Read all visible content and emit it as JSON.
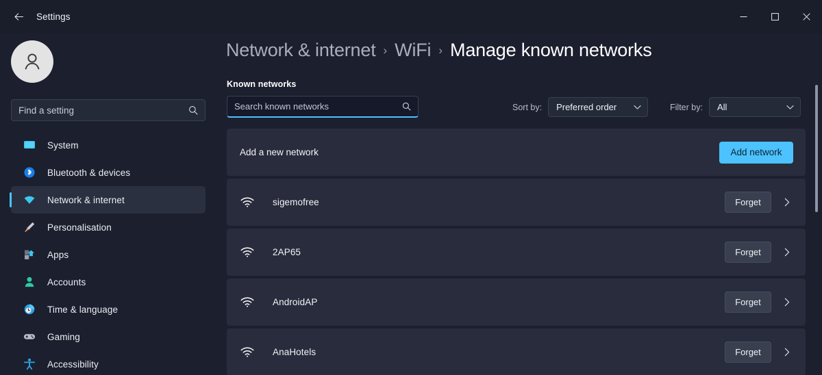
{
  "titlebar": {
    "back_label": "back-arrow",
    "app_title": "Settings",
    "minimize": "−",
    "maximize": "☐",
    "close": "✕"
  },
  "sidebar": {
    "search": {
      "placeholder": "Find a setting",
      "value": ""
    },
    "items": [
      {
        "label": "System",
        "icon": "monitor-icon",
        "active": false
      },
      {
        "label": "Bluetooth & devices",
        "icon": "bluetooth-icon",
        "active": false
      },
      {
        "label": "Network & internet",
        "icon": "wifi-icon",
        "active": true
      },
      {
        "label": "Personalisation",
        "icon": "paintbrush-icon",
        "active": false
      },
      {
        "label": "Apps",
        "icon": "apps-icon",
        "active": false
      },
      {
        "label": "Accounts",
        "icon": "person-icon",
        "active": false
      },
      {
        "label": "Time & language",
        "icon": "clock-icon",
        "active": false
      },
      {
        "label": "Gaming",
        "icon": "gamepad-icon",
        "active": false
      },
      {
        "label": "Accessibility",
        "icon": "accessibility-icon",
        "active": false
      }
    ]
  },
  "main": {
    "breadcrumb": [
      {
        "label": "Network & internet",
        "current": false
      },
      {
        "label": "WiFi",
        "current": false
      },
      {
        "label": "Manage known networks",
        "current": true
      }
    ],
    "breadcrumb_separator": "›",
    "section_label": "Known networks",
    "search": {
      "placeholder": "Search known networks",
      "value": ""
    },
    "sort": {
      "caption": "Sort by:",
      "value": "Preferred order"
    },
    "filter": {
      "caption": "Filter by:",
      "value": "All"
    },
    "add_network_row": {
      "text": "Add a new network",
      "button_label": "Add network"
    },
    "forget_label": "Forget",
    "networks": [
      {
        "name": "sigemofree"
      },
      {
        "name": "2AP65"
      },
      {
        "name": "AndroidAP"
      },
      {
        "name": "AnaHotels"
      }
    ]
  },
  "colors": {
    "accent": "#4cc2ff",
    "page_bg": "#1b1f2e",
    "card_bg": "#282c3c",
    "titlebar_bg": "#1a1e2b"
  }
}
